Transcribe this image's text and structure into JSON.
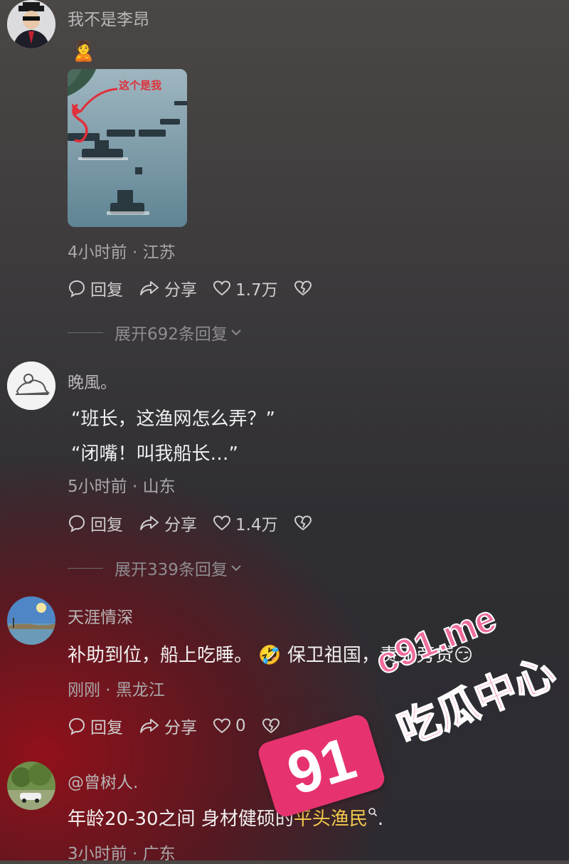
{
  "comments": [
    {
      "username": "我不是李昂",
      "emoji": "🙎",
      "image_caption": "这个是我",
      "meta": "4小时前 · 江苏",
      "reply_label": "回复",
      "share_label": "分享",
      "likes": "1.7万",
      "expand_label": "展开692条回复"
    },
    {
      "username": "晚風。",
      "lines": [
        "“班长，这渔网怎么弄？”",
        "“闭嘴！叫我船长…”"
      ],
      "meta": "5小时前 · 山东",
      "reply_label": "回复",
      "share_label": "分享",
      "likes": "1.4万",
      "expand_label": "展开339条回复"
    },
    {
      "username": "天涯情深",
      "text_a": "补助到位，船上吃睡。",
      "emoji_a": "🤣",
      "text_b": "保卫祖国，责无旁贷",
      "emoji_b": "😏",
      "meta": "刚刚 · 黑龙江",
      "reply_label": "回复",
      "share_label": "分享",
      "likes": "0"
    },
    {
      "username": "@曾树人.",
      "text_a": "年龄20-30之间 身材健硕的",
      "highlight": "平头渔民",
      "text_end": ".",
      "meta": "3小时前 · 广东"
    }
  ],
  "watermark": {
    "badge": "91",
    "url": "c91.me",
    "name": "吃瓜中心"
  },
  "colors": {
    "highlight": "#f2c94c",
    "watermark_pink": "#e6336f"
  }
}
